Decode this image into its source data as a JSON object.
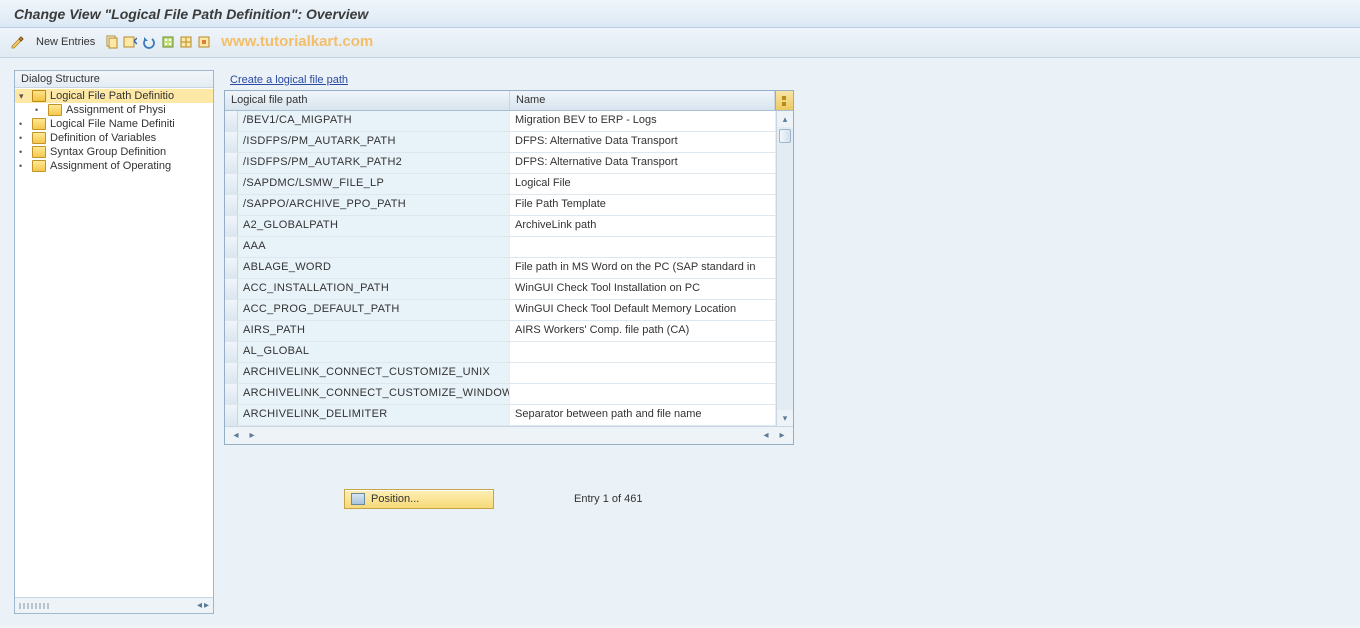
{
  "title": "Change View \"Logical File Path Definition\": Overview",
  "toolbar": {
    "new_entries": "New Entries"
  },
  "watermark": "www.tutorialkart.com",
  "tree": {
    "header": "Dialog Structure",
    "nodes": [
      {
        "label": "Logical File Path Definitio",
        "level": 0,
        "open": true,
        "selected": true,
        "expander": "▾"
      },
      {
        "label": "Assignment of Physi",
        "level": 1,
        "open": false,
        "selected": false,
        "expander": "•"
      },
      {
        "label": "Logical File Name Definiti",
        "level": 0,
        "open": false,
        "selected": false,
        "expander": "•"
      },
      {
        "label": "Definition of Variables",
        "level": 0,
        "open": false,
        "selected": false,
        "expander": "•"
      },
      {
        "label": "Syntax Group Definition",
        "level": 0,
        "open": false,
        "selected": false,
        "expander": "•"
      },
      {
        "label": "Assignment of Operating",
        "level": 0,
        "open": false,
        "selected": false,
        "expander": "•"
      }
    ]
  },
  "main": {
    "link": "Create a logical file path",
    "columns": {
      "path": "Logical file path",
      "name": "Name"
    },
    "rows": [
      {
        "path": "/BEV1/CA_MIGPATH",
        "name": "Migration BEV to ERP - Logs"
      },
      {
        "path": "/ISDFPS/PM_AUTARK_PATH",
        "name": "DFPS: Alternative Data Transport"
      },
      {
        "path": "/ISDFPS/PM_AUTARK_PATH2",
        "name": "DFPS: Alternative Data Transport"
      },
      {
        "path": "/SAPDMC/LSMW_FILE_LP",
        "name": "Logical File"
      },
      {
        "path": "/SAPPO/ARCHIVE_PPO_PATH",
        "name": "File Path Template"
      },
      {
        "path": "A2_GLOBALPATH",
        "name": "ArchiveLink path"
      },
      {
        "path": "AAA",
        "name": ""
      },
      {
        "path": "ABLAGE_WORD",
        "name": "File path in MS Word on the PC (SAP standard in"
      },
      {
        "path": "ACC_INSTALLATION_PATH",
        "name": "WinGUI Check Tool Installation on PC"
      },
      {
        "path": "ACC_PROG_DEFAULT_PATH",
        "name": "WinGUI Check Tool Default Memory Location"
      },
      {
        "path": "AIRS_PATH",
        "name": "AIRS Workers' Comp. file path (CA)"
      },
      {
        "path": "AL_GLOBAL",
        "name": ""
      },
      {
        "path": "ARCHIVELINK_CONNECT_CUSTOMIZE_UNIX",
        "name": ""
      },
      {
        "path": "ARCHIVELINK_CONNECT_CUSTOMIZE_WINDOWS",
        "name": ""
      },
      {
        "path": "ARCHIVELINK_DELIMITER",
        "name": "Separator between path and file name"
      }
    ],
    "position_label": "Position...",
    "entry_of": "Entry 1 of 461"
  }
}
